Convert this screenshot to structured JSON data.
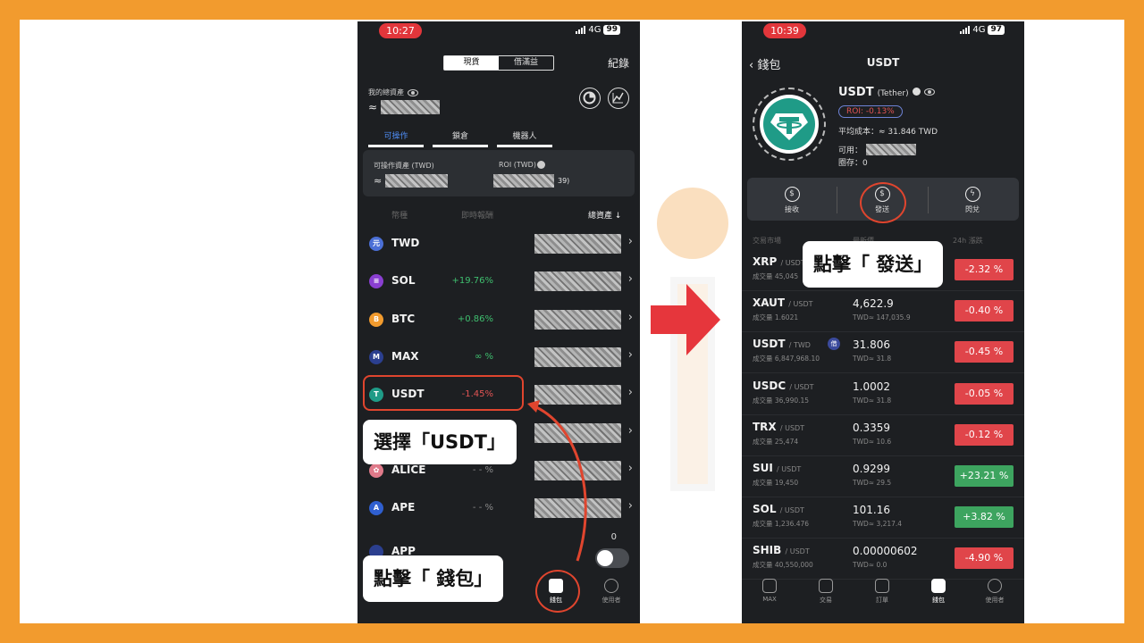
{
  "left": {
    "status": {
      "time": "10:27",
      "network": "4G",
      "battery": "99"
    },
    "segment": {
      "spot": "現貨",
      "lending": "借滿益"
    },
    "record_label": "紀錄",
    "total_assets_label": "我的總資產",
    "total_prefix": "≈",
    "tabs": [
      "可操作",
      "鎖倉",
      "機器人"
    ],
    "operable": {
      "label": "可操作資產 (TWD)",
      "roi_label": "ROI (TWD)",
      "prefix": "≈",
      "roi_suffix": "39)"
    },
    "columns": {
      "currency": "幣種",
      "change": "即時報酬",
      "total": "總資產 ↓"
    },
    "coins": [
      {
        "name": "TWD",
        "change": "",
        "icon": "元",
        "color": "#4b6fd6",
        "trend": ""
      },
      {
        "name": "SOL",
        "change": "+19.76%",
        "icon": "≡",
        "color": "#8a3fd1",
        "trend": "up"
      },
      {
        "name": "BTC",
        "change": "+0.86%",
        "icon": "B",
        "color": "#f29b2e",
        "trend": "up"
      },
      {
        "name": "MAX",
        "change": "∞ %",
        "icon": "M",
        "color": "#2b3f8f",
        "trend": "up"
      },
      {
        "name": "USDT",
        "change": "-1.45%",
        "icon": "T",
        "color": "#1f9b87",
        "trend": "down"
      },
      {
        "name": "",
        "change": "",
        "icon": "",
        "color": "#555",
        "trend": ""
      },
      {
        "name": "ALICE",
        "change": "- - %",
        "icon": "✿",
        "color": "#e07a8a",
        "trend": "flat"
      },
      {
        "name": "APE",
        "change": "- - %",
        "icon": "A",
        "color": "#2f5fd0",
        "trend": "flat"
      }
    ],
    "partial_row": {
      "name": "APP",
      "balance": "0"
    },
    "callout_select": "選擇「USDT」",
    "callout_wallet": "點擊「 錢包」",
    "nav": {
      "wallet": "錢包",
      "user": "使用者"
    }
  },
  "right": {
    "status": {
      "time": "10:39",
      "network": "4G",
      "battery": "97"
    },
    "back_label": "錢包",
    "title": "USDT",
    "coin_name": "USDT",
    "coin_sub": "(Tether)",
    "roi": "ROI: -0.13%",
    "avg_cost": "平均成本：≈ 31.846 TWD",
    "available_label": "可用：",
    "stock_label": "圈存：0",
    "actions": [
      "接收",
      "發送",
      "閃兌"
    ],
    "market_columns": {
      "market": "交易市場",
      "price": "最新價",
      "change": "24h 漲跌"
    },
    "callout_send": "點擊「 發送」",
    "markets": [
      {
        "base": "XRP",
        "quote": "/ USDT",
        "volume": "成交量 45,045",
        "price": "",
        "twd": "",
        "change": "-2.32 %",
        "dir": "neg"
      },
      {
        "base": "XAUT",
        "quote": "/ USDT",
        "volume": "成交量 1.6021",
        "price": "4,622.9",
        "twd": "TWD≈ 147,035.9",
        "change": "-0.40 %",
        "dir": "neg"
      },
      {
        "base": "USDT",
        "quote": "/ TWD",
        "volume": "成交量 6,847,968.10",
        "price": "31.806",
        "twd": "TWD≈ 31.8",
        "change": "-0.45 %",
        "dir": "neg",
        "tag": "借"
      },
      {
        "base": "USDC",
        "quote": "/ USDT",
        "volume": "成交量 36,990.15",
        "price": "1.0002",
        "twd": "TWD≈ 31.8",
        "change": "-0.05 %",
        "dir": "neg"
      },
      {
        "base": "TRX",
        "quote": "/ USDT",
        "volume": "成交量 25,474",
        "price": "0.3359",
        "twd": "TWD≈ 10.6",
        "change": "-0.12 %",
        "dir": "neg"
      },
      {
        "base": "SUI",
        "quote": "/ USDT",
        "volume": "成交量 19,450",
        "price": "0.9299",
        "twd": "TWD≈ 29.5",
        "change": "+23.21 %",
        "dir": "pos"
      },
      {
        "base": "SOL",
        "quote": "/ USDT",
        "volume": "成交量 1,236.476",
        "price": "101.16",
        "twd": "TWD≈ 3,217.4",
        "change": "+3.82 %",
        "dir": "pos"
      },
      {
        "base": "SHIB",
        "quote": "/ USDT",
        "volume": "成交量 40,550,000",
        "price": "0.00000602",
        "twd": "TWD≈ 0.0",
        "change": "-4.90 %",
        "dir": "neg"
      }
    ],
    "nav": [
      "MAX",
      "交易",
      "訂單",
      "錢包",
      "使用者"
    ]
  }
}
